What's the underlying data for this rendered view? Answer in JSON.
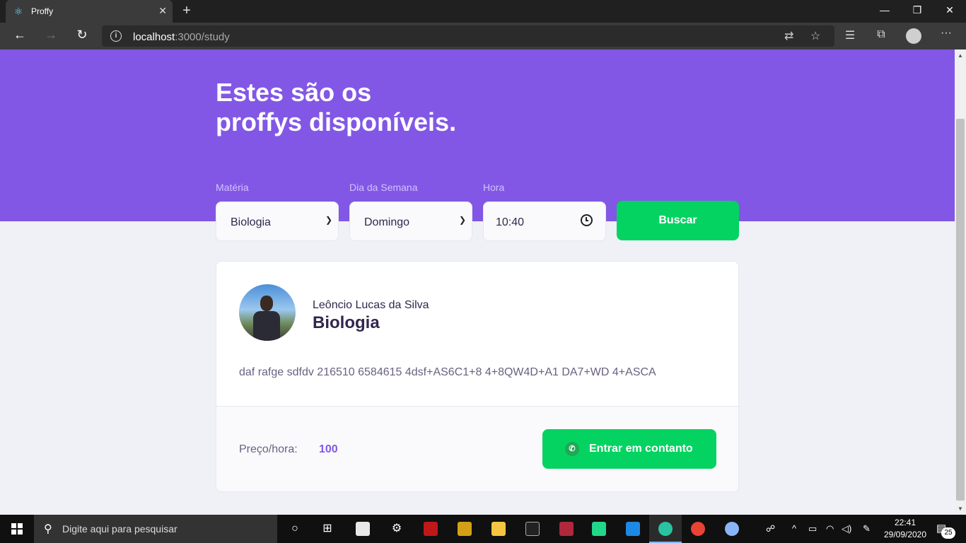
{
  "browser": {
    "tab_title": "Proffy",
    "url_host": "localhost",
    "url_path": ":3000/study"
  },
  "page": {
    "title_line1": "Estes são os",
    "title_line2": "proffys disponíveis.",
    "filters": {
      "subject_label": "Matéria",
      "subject_value": "Biologia",
      "weekday_label": "Dia da Semana",
      "weekday_value": "Domingo",
      "time_label": "Hora",
      "time_value": "10:40",
      "search_button": "Buscar"
    },
    "teacher": {
      "name": "Leôncio Lucas da Silva",
      "subject": "Biologia",
      "bio": "daf rafge sdfdv 216510 6584615 4dsf+AS6C1+8 4+8QW4D+A1 DA7+WD 4+ASCA",
      "price_label": "Preço/hora:",
      "price_value": "100",
      "contact_button": "Entrar em contanto"
    },
    "colors": {
      "primary": "#8257e5",
      "secondary": "#04d361",
      "background": "#f0f0f7"
    }
  },
  "taskbar": {
    "search_placeholder": "Digite aqui para pesquisar",
    "time": "22:41",
    "date": "29/09/2020",
    "notification_count": "25"
  }
}
